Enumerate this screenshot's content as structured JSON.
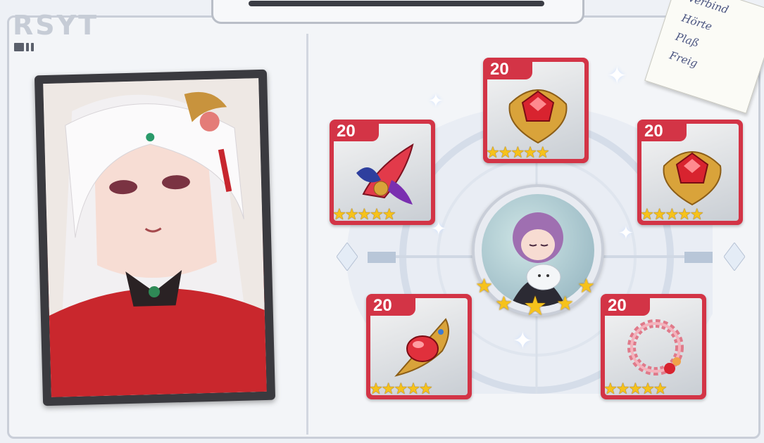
{
  "header": {
    "logo_text": "RSYT"
  },
  "note": {
    "lines": [
      "Verbind",
      "Hörte",
      "Plaß",
      "Freig"
    ]
  },
  "equipment": [
    {
      "slot": "top",
      "level": "20",
      "stars": 5,
      "icon": "ruby-brooch-icon"
    },
    {
      "slot": "upper-left",
      "level": "20",
      "stars": 5,
      "icon": "feather-wing-icon"
    },
    {
      "slot": "upper-right",
      "level": "20",
      "stars": 5,
      "icon": "ruby-brooch-icon"
    },
    {
      "slot": "lower-left",
      "level": "20",
      "stars": 5,
      "icon": "ruby-scepter-icon"
    },
    {
      "slot": "lower-right",
      "level": "20",
      "stars": 5,
      "icon": "flower-wreath-icon"
    }
  ],
  "character": {
    "stars": 5
  },
  "colors": {
    "card_red": "#d33446",
    "star_gold": "#f6c21b"
  }
}
